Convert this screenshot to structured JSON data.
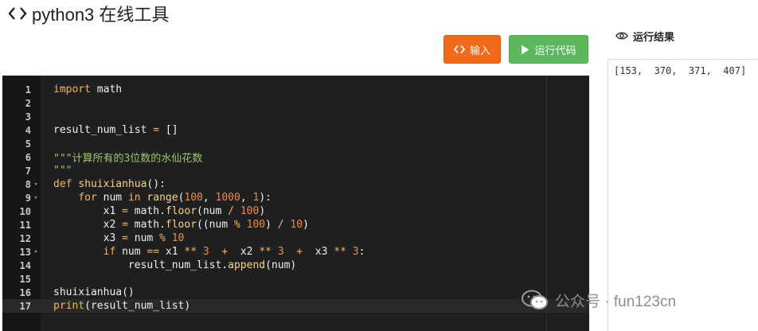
{
  "header": {
    "title": "python3 在线工具"
  },
  "toolbar": {
    "input_label": "输入",
    "run_label": "运行代码"
  },
  "editor": {
    "lines": [
      {
        "n": "1",
        "fold": false
      },
      {
        "n": "2",
        "fold": false
      },
      {
        "n": "3",
        "fold": false
      },
      {
        "n": "4",
        "fold": false
      },
      {
        "n": "5",
        "fold": false
      },
      {
        "n": "6",
        "fold": false
      },
      {
        "n": "7",
        "fold": false
      },
      {
        "n": "8",
        "fold": true
      },
      {
        "n": "9",
        "fold": true
      },
      {
        "n": "10",
        "fold": false
      },
      {
        "n": "11",
        "fold": false
      },
      {
        "n": "12",
        "fold": false
      },
      {
        "n": "13",
        "fold": true
      },
      {
        "n": "14",
        "fold": false
      },
      {
        "n": "15",
        "fold": false
      },
      {
        "n": "16",
        "fold": false
      },
      {
        "n": "17",
        "fold": false
      }
    ],
    "code_tokens": [
      [
        [
          "kw",
          "import"
        ],
        [
          "t",
          " math"
        ]
      ],
      [],
      [],
      [
        [
          "t",
          "result_num_list "
        ],
        [
          "op",
          "="
        ],
        [
          "t",
          " []"
        ]
      ],
      [],
      [
        [
          "str",
          "\"\"\"计算所有的3位数的水仙花数"
        ]
      ],
      [
        [
          "str",
          "\"\"\""
        ]
      ],
      [
        [
          "kw",
          "def"
        ],
        [
          "t",
          " "
        ],
        [
          "fn",
          "shuixianhua"
        ],
        [
          "t",
          "():"
        ]
      ],
      [
        [
          "t",
          "    "
        ],
        [
          "kw",
          "for"
        ],
        [
          "t",
          " num "
        ],
        [
          "kw",
          "in"
        ],
        [
          "t",
          " "
        ],
        [
          "fn",
          "range"
        ],
        [
          "t",
          "("
        ],
        [
          "num",
          "100"
        ],
        [
          "t",
          ", "
        ],
        [
          "num",
          "1000"
        ],
        [
          "t",
          ", "
        ],
        [
          "num",
          "1"
        ],
        [
          "t",
          "):"
        ]
      ],
      [
        [
          "t",
          "        x1 "
        ],
        [
          "op",
          "="
        ],
        [
          "t",
          " math."
        ],
        [
          "fn",
          "floor"
        ],
        [
          "t",
          "(num "
        ],
        [
          "op",
          "/"
        ],
        [
          "t",
          " "
        ],
        [
          "num",
          "100"
        ],
        [
          "t",
          ")"
        ]
      ],
      [
        [
          "t",
          "        x2 "
        ],
        [
          "op",
          "="
        ],
        [
          "t",
          " math."
        ],
        [
          "fn",
          "floor"
        ],
        [
          "t",
          "((num "
        ],
        [
          "op",
          "%"
        ],
        [
          "t",
          " "
        ],
        [
          "num",
          "100"
        ],
        [
          "t",
          ") "
        ],
        [
          "op",
          "/"
        ],
        [
          "t",
          " "
        ],
        [
          "num",
          "10"
        ],
        [
          "t",
          ")"
        ]
      ],
      [
        [
          "t",
          "        x3 "
        ],
        [
          "op",
          "="
        ],
        [
          "t",
          " num "
        ],
        [
          "op",
          "%"
        ],
        [
          "t",
          " "
        ],
        [
          "num",
          "10"
        ]
      ],
      [
        [
          "t",
          "        "
        ],
        [
          "kw",
          "if"
        ],
        [
          "t",
          " num "
        ],
        [
          "op",
          "=="
        ],
        [
          "t",
          " x1 "
        ],
        [
          "op",
          "**"
        ],
        [
          "t",
          " "
        ],
        [
          "num",
          "3"
        ],
        [
          "t",
          "  "
        ],
        [
          "op",
          "+"
        ],
        [
          "t",
          "  x2 "
        ],
        [
          "op",
          "**"
        ],
        [
          "t",
          " "
        ],
        [
          "num",
          "3"
        ],
        [
          "t",
          "  "
        ],
        [
          "op",
          "+"
        ],
        [
          "t",
          "  x3 "
        ],
        [
          "op",
          "**"
        ],
        [
          "t",
          " "
        ],
        [
          "num",
          "3"
        ],
        [
          "t",
          ":"
        ]
      ],
      [
        [
          "t",
          "            result_num_list."
        ],
        [
          "fn",
          "append"
        ],
        [
          "t",
          "(num)"
        ]
      ],
      [],
      [
        [
          "t",
          "shuixianhua()"
        ]
      ],
      [
        [
          "kw",
          "print"
        ],
        [
          "t",
          "(result_num_list)"
        ]
      ]
    ],
    "active_line": 17
  },
  "result": {
    "heading": "运行结果",
    "output": "[153,  370,  371,  407]"
  },
  "watermark": {
    "text": "公众号 · fun123cn"
  },
  "colors": {
    "input_button": "#f26a19",
    "run_button": "#5cb85c",
    "editor_bg": "#1d1f21"
  }
}
